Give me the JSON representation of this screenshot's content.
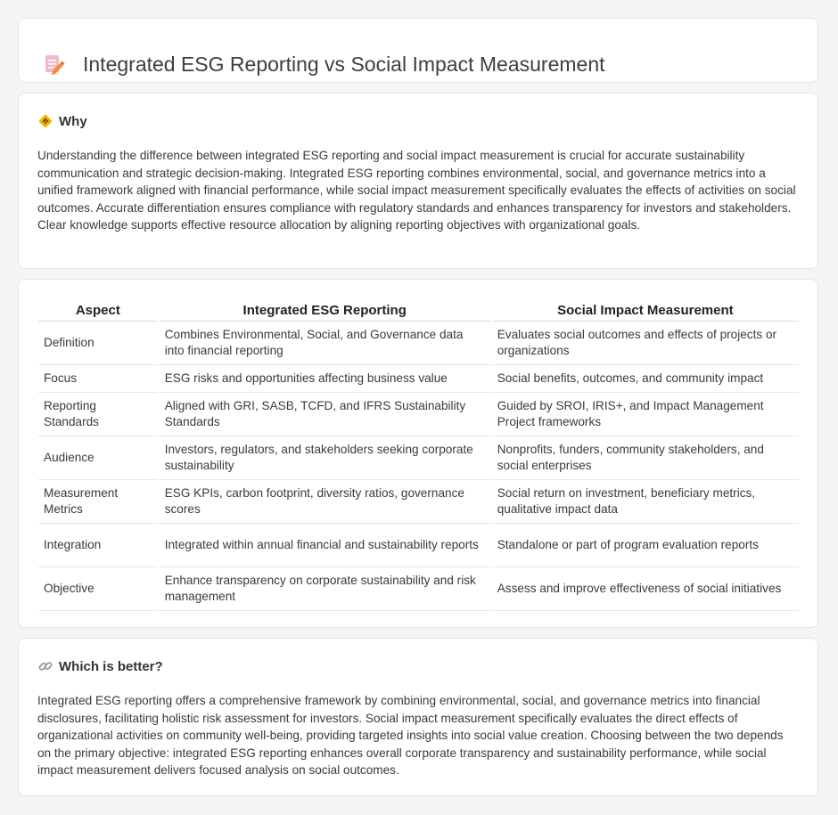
{
  "header": {
    "title": "Integrated ESG Reporting vs Social Impact Measurement",
    "icon": "document-edit-icon"
  },
  "why": {
    "icon": "diamond-sign-icon",
    "title": "Why",
    "text": "Understanding the difference between integrated ESG reporting and social impact measurement is crucial for accurate sustainability communication and strategic decision-making. Integrated ESG reporting combines environmental, social, and governance metrics into a unified framework aligned with financial performance, while social impact measurement specifically evaluates the effects of activities on social outcomes. Accurate differentiation ensures compliance with regulatory standards and enhances transparency for investors and stakeholders. Clear knowledge supports effective resource allocation by aligning reporting objectives with organizational goals."
  },
  "table": {
    "headers": [
      "Aspect",
      "Integrated ESG Reporting",
      "Social Impact Measurement"
    ],
    "rows": [
      [
        "Definition",
        "Combines Environmental, Social, and Governance data into financial reporting",
        "Evaluates social outcomes and effects of projects or organizations"
      ],
      [
        "Focus",
        "ESG risks and opportunities affecting business value",
        "Social benefits, outcomes, and community impact"
      ],
      [
        "Reporting Standards",
        "Aligned with GRI, SASB, TCFD, and IFRS Sustainability Standards",
        "Guided by SROI, IRIS+, and Impact Management Project frameworks"
      ],
      [
        "Audience",
        "Investors, regulators, and stakeholders seeking corporate sustainability",
        "Nonprofits, funders, community stakeholders, and social enterprises"
      ],
      [
        "Measurement Metrics",
        "ESG KPIs, carbon footprint, diversity ratios, governance scores",
        "Social return on investment, beneficiary metrics, qualitative impact data"
      ],
      [
        "Integration",
        "Integrated within annual financial and sustainability reports",
        "Standalone or part of program evaluation reports"
      ],
      [
        "Objective",
        "Enhance transparency on corporate sustainability and risk management",
        "Assess and improve effectiveness of social initiatives"
      ]
    ]
  },
  "better": {
    "icon": "link-icon",
    "title": "Which is better?",
    "text": "Integrated ESG reporting offers a comprehensive framework by combining environmental, social, and governance metrics into financial disclosures, facilitating holistic risk assessment for investors. Social impact measurement specifically evaluates the direct effects of organizational activities on community well-being, providing targeted insights into social value creation. Choosing between the two depends on the primary objective: integrated ESG reporting enhances overall corporate transparency and sustainability performance, while social impact measurement delivers focused analysis on social outcomes."
  },
  "colors": {
    "background": "#f4f5f7",
    "card": "#ffffff",
    "icon_orange": "#f08a3c",
    "icon_pink": "#f2b8c6",
    "sign_yellow": "#f5b400"
  }
}
